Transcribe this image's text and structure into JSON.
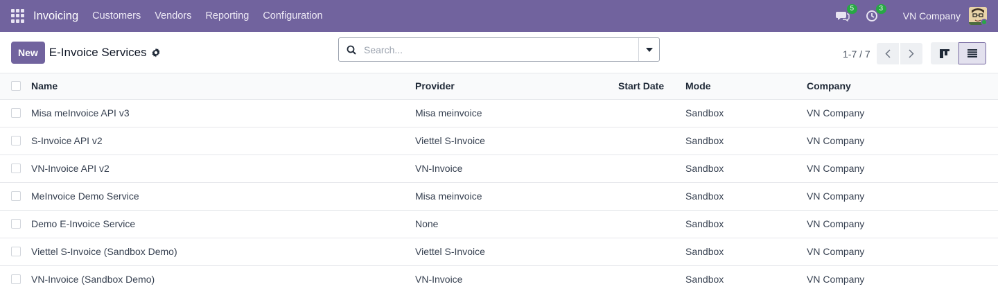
{
  "navbar": {
    "app_name": "Invoicing",
    "menu": [
      {
        "label": "Customers"
      },
      {
        "label": "Vendors"
      },
      {
        "label": "Reporting"
      },
      {
        "label": "Configuration"
      }
    ],
    "messages_count": "5",
    "activities_count": "3",
    "company": "VN Company"
  },
  "control_panel": {
    "new_label": "New",
    "title": "E-Invoice Services",
    "search_placeholder": "Search...",
    "pager": "1-7 / 7"
  },
  "table": {
    "columns": {
      "name": "Name",
      "provider": "Provider",
      "start_date": "Start Date",
      "mode": "Mode",
      "company": "Company"
    },
    "rows": [
      {
        "name": "Misa meInvoice API v3",
        "provider": "Misa meinvoice",
        "start_date": "",
        "mode": "Sandbox",
        "company": "VN Company"
      },
      {
        "name": "S-Invoice API v2",
        "provider": "Viettel S-Invoice",
        "start_date": "",
        "mode": "Sandbox",
        "company": "VN Company"
      },
      {
        "name": "VN-Invoice API v2",
        "provider": "VN-Invoice",
        "start_date": "",
        "mode": "Sandbox",
        "company": "VN Company"
      },
      {
        "name": "MeInvoice Demo Service",
        "provider": "Misa meinvoice",
        "start_date": "",
        "mode": "Sandbox",
        "company": "VN Company"
      },
      {
        "name": "Demo E-Invoice Service",
        "provider": "None",
        "start_date": "",
        "mode": "Sandbox",
        "company": "VN Company"
      },
      {
        "name": "Viettel S-Invoice (Sandbox Demo)",
        "provider": "Viettel S-Invoice",
        "start_date": "",
        "mode": "Sandbox",
        "company": "VN Company"
      },
      {
        "name": "VN-Invoice (Sandbox Demo)",
        "provider": "VN-Invoice",
        "start_date": "",
        "mode": "Sandbox",
        "company": "VN Company"
      }
    ]
  },
  "colors": {
    "navbar": "#71639e",
    "badge": "#28a745"
  }
}
